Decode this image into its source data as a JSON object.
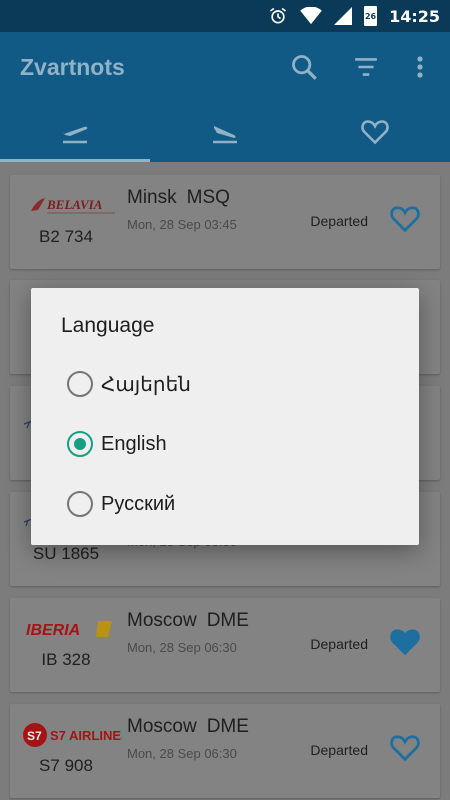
{
  "status_bar": {
    "time": "14:25",
    "battery_level": "26",
    "icons": [
      "alarm-icon",
      "wifi-icon",
      "signal-icon",
      "battery-icon"
    ]
  },
  "app_bar": {
    "title": "Zvartnots",
    "actions": [
      "search-icon",
      "sort-icon",
      "more-vert-icon"
    ]
  },
  "tabs": [
    {
      "icon": "departures-icon",
      "selected": true
    },
    {
      "icon": "arrivals-icon",
      "selected": false
    },
    {
      "icon": "favorites-icon",
      "selected": false
    }
  ],
  "flights": [
    {
      "airline": "BELAVIA",
      "flight_no": "B2 734",
      "city": "Minsk",
      "code": "MSQ",
      "datetime": "Mon, 28 Sep 03:45",
      "status": "Departed",
      "favorite": false
    },
    {
      "airline": "",
      "flight_no": "",
      "city": "",
      "code": "",
      "datetime": "",
      "status": "",
      "favorite": false
    },
    {
      "airline": "",
      "flight_no": "",
      "city": "",
      "code": "",
      "datetime": "",
      "status": "",
      "favorite": false
    },
    {
      "airline": "",
      "flight_no": "SU 1865",
      "city": "",
      "code": "",
      "datetime": "Mon, 28 Sep 06:30",
      "status": "",
      "favorite": false
    },
    {
      "airline": "IBERIA",
      "flight_no": "IB 328",
      "city": "Moscow",
      "code": "DME",
      "datetime": "Mon, 28 Sep 06:30",
      "status": "Departed",
      "favorite": true
    },
    {
      "airline": "S7 AIRLINES",
      "flight_no": "S7 908",
      "city": "Moscow",
      "code": "DME",
      "datetime": "Mon, 28 Sep 06:30",
      "status": "Departed",
      "favorite": false
    }
  ],
  "dialog": {
    "title": "Language",
    "options": [
      {
        "label": "Հայերեն",
        "selected": false
      },
      {
        "label": "English",
        "selected": true
      },
      {
        "label": "Русский",
        "selected": false
      }
    ]
  },
  "colors": {
    "app_bar": "#125a86",
    "status_bar": "#0a3a57",
    "accent_radio": "#15a085",
    "favorite_icon": "#1d6f9f"
  }
}
